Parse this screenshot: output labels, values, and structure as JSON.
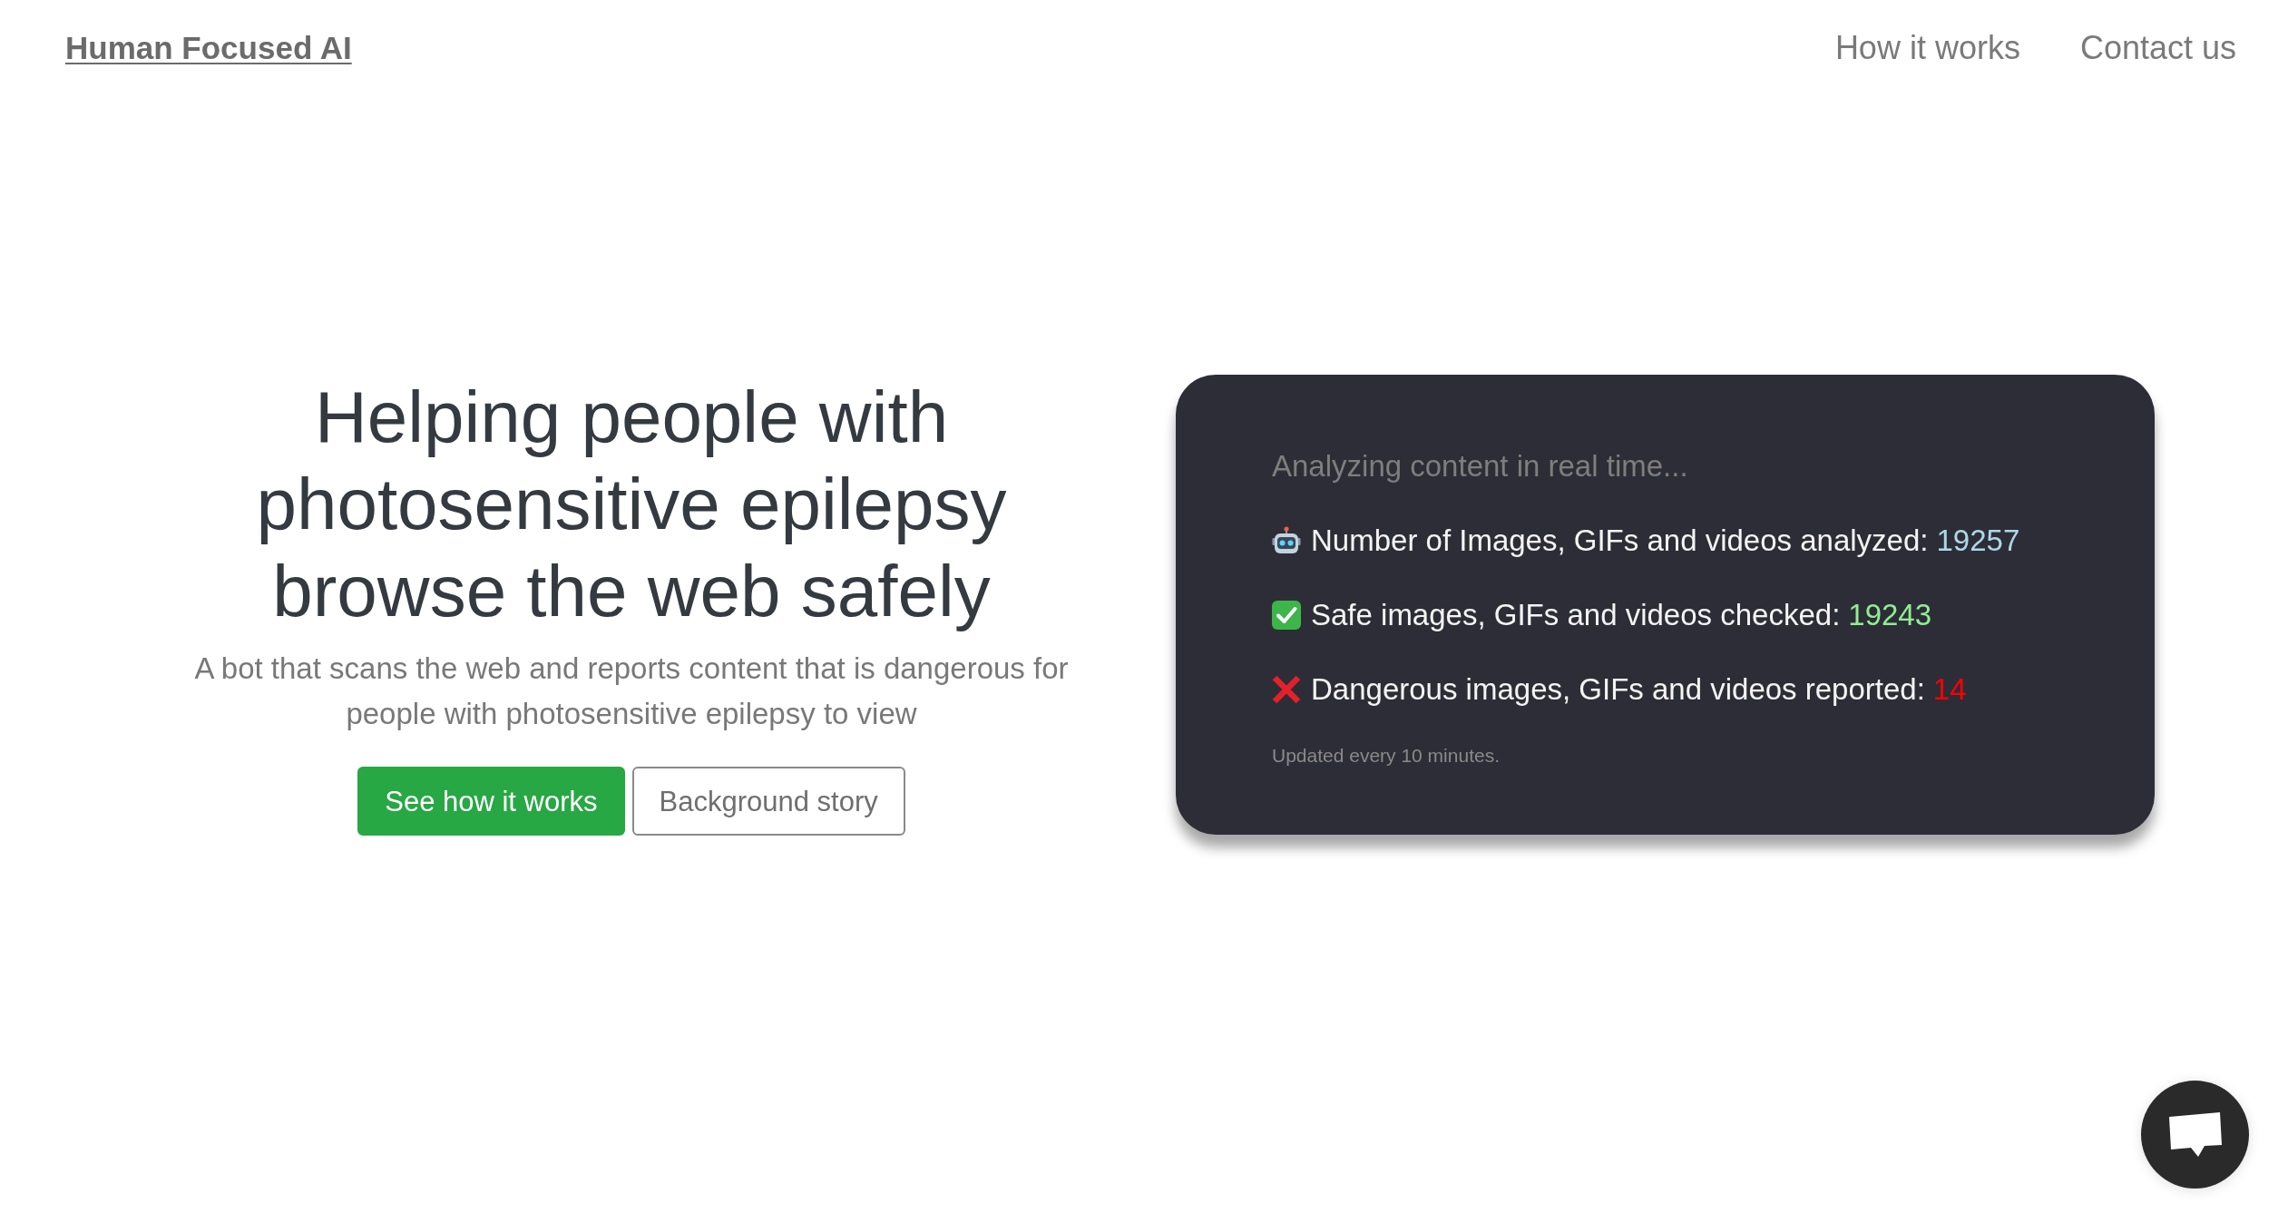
{
  "navbar": {
    "brand": "Human Focused AI",
    "links": [
      "How it works",
      "Contact us"
    ]
  },
  "hero": {
    "title": "Helping people with photosensitive epilepsy browse the web safely",
    "subtitle": "A bot that scans the web and reports content that is dangerous for people with photosensitive epilepsy to view",
    "buttons": [
      {
        "label": "See how it works",
        "kind": "primary"
      },
      {
        "label": "Background story",
        "kind": "outline"
      }
    ]
  },
  "stats_card": {
    "heading": "Analyzing content in real time...",
    "stats": [
      {
        "kind": "total",
        "label": "Number of Images, GIFs and videos analyzed:",
        "value": "19257",
        "color": "#add8e6"
      },
      {
        "kind": "safe",
        "label": "Safe images, GIFs and videos checked:",
        "value": "19243",
        "color": "#90ee90"
      },
      {
        "kind": "dangerous",
        "label": "Dangerous images, GIFs and videos reported:",
        "value": "14",
        "color": "#ff0000"
      }
    ],
    "footnote": "Updated every 10 minutes."
  }
}
